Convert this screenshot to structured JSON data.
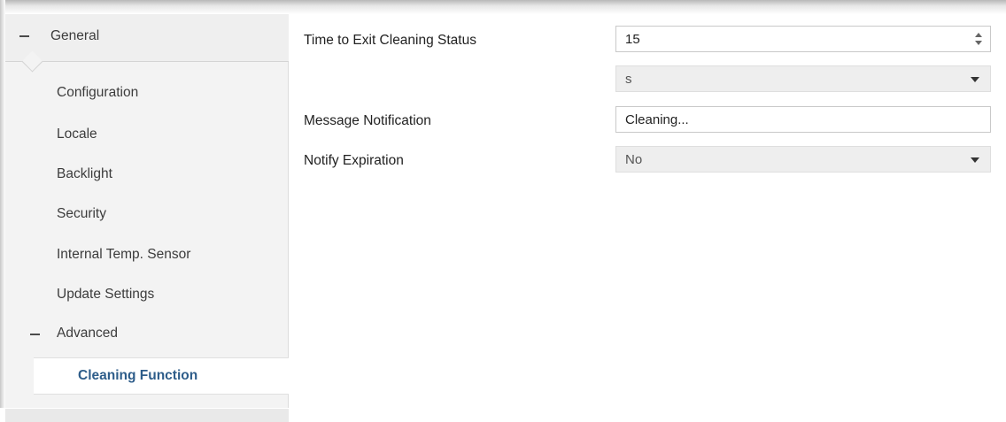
{
  "sidebar": {
    "general": {
      "label": "General"
    },
    "items": [
      {
        "label": "Configuration"
      },
      {
        "label": "Locale"
      },
      {
        "label": "Backlight"
      },
      {
        "label": "Security"
      },
      {
        "label": "Internal Temp. Sensor"
      },
      {
        "label": "Update Settings"
      }
    ],
    "advanced": {
      "label": "Advanced"
    },
    "active": {
      "label": "Cleaning Function"
    }
  },
  "form": {
    "time_to_exit": {
      "label": "Time to Exit Cleaning Status",
      "value": "15"
    },
    "time_unit": {
      "value": "s"
    },
    "message_notification": {
      "label": "Message Notification",
      "value": "Cleaning..."
    },
    "notify_expiration": {
      "label": "Notify Expiration",
      "value": "No"
    }
  }
}
